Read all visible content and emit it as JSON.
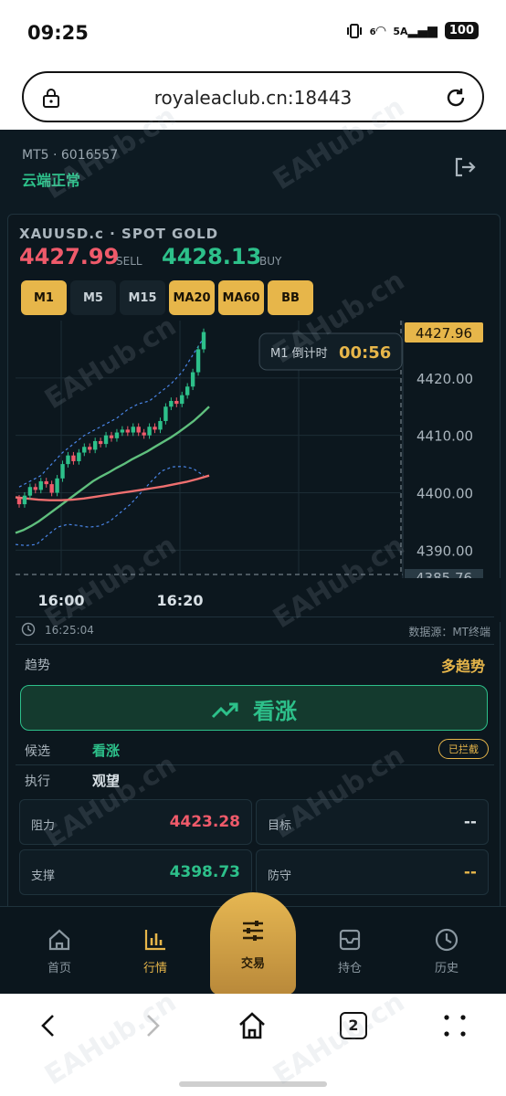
{
  "status": {
    "time": "09:25",
    "network": "5A",
    "wifi_label": "6",
    "battery": "100"
  },
  "browser": {
    "url": "royaleaclub.cn:18443",
    "tab_count": "2"
  },
  "account": {
    "id": "MT5 · 6016557",
    "cloud_status": "云端正常"
  },
  "symbol": {
    "name": "XAUUSD.c · SPOT GOLD",
    "sell_price": "4427.99",
    "sell_label": "SELL",
    "buy_price": "4428.13",
    "buy_label": "BUY"
  },
  "timeframes": [
    {
      "label": "M1",
      "active": true
    },
    {
      "label": "M5",
      "active": false
    },
    {
      "label": "M15",
      "active": false
    }
  ],
  "indicators": [
    "MA20",
    "MA60",
    "BB"
  ],
  "chart_data": {
    "type": "candlestick",
    "y_ticks": [
      "4420.00",
      "4410.00",
      "4400.00",
      "4390.00"
    ],
    "ylim": [
      4385.76,
      4430
    ],
    "x_ticks": [
      "16:00",
      "16:20"
    ],
    "current_price_tag": "4427.96",
    "bottom_price_tag": "4385.76",
    "countdown_label": "M1 倒计时",
    "countdown_value": "00:56",
    "candles": [
      {
        "o": 4399.0,
        "c": 4398.0
      },
      {
        "o": 4398.0,
        "c": 4399.5
      },
      {
        "o": 4399.5,
        "c": 4401.0
      },
      {
        "o": 4401.0,
        "c": 4400.5
      },
      {
        "o": 4400.5,
        "c": 4402.0
      },
      {
        "o": 4402.0,
        "c": 4401.5
      },
      {
        "o": 4401.5,
        "c": 4400.0
      },
      {
        "o": 4400.0,
        "c": 4402.5
      },
      {
        "o": 4402.5,
        "c": 4405.0
      },
      {
        "o": 4405.0,
        "c": 4406.5
      },
      {
        "o": 4406.5,
        "c": 4405.5
      },
      {
        "o": 4405.5,
        "c": 4407.0
      },
      {
        "o": 4407.0,
        "c": 4408.0
      },
      {
        "o": 4408.0,
        "c": 4407.5
      },
      {
        "o": 4407.5,
        "c": 4409.0
      },
      {
        "o": 4409.0,
        "c": 4408.5
      },
      {
        "o": 4408.5,
        "c": 4410.0
      },
      {
        "o": 4410.0,
        "c": 4409.5
      },
      {
        "o": 4409.5,
        "c": 4410.5
      },
      {
        "o": 4410.5,
        "c": 4411.0
      },
      {
        "o": 4411.0,
        "c": 4410.5
      },
      {
        "o": 4410.5,
        "c": 4411.5
      },
      {
        "o": 4411.5,
        "c": 4410.5
      },
      {
        "o": 4410.5,
        "c": 4410.0
      },
      {
        "o": 4410.0,
        "c": 4411.5
      },
      {
        "o": 4411.5,
        "c": 4411.0
      },
      {
        "o": 4411.0,
        "c": 4412.5
      },
      {
        "o": 4412.5,
        "c": 4415.0
      },
      {
        "o": 4415.0,
        "c": 4416.0
      },
      {
        "o": 4416.0,
        "c": 4415.5
      },
      {
        "o": 4415.5,
        "c": 4417.0
      },
      {
        "o": 4417.0,
        "c": 4418.5
      },
      {
        "o": 4418.5,
        "c": 4421.0
      },
      {
        "o": 4421.0,
        "c": 4425.0
      },
      {
        "o": 4425.0,
        "c": 4428.0
      }
    ],
    "ma20": [
      4393.0,
      4393.5,
      4394.2,
      4395.0,
      4396.0,
      4397.0,
      4398.0,
      4399.0,
      4400.0,
      4401.0,
      4402.0,
      4402.8,
      4403.5,
      4404.3,
      4405.0,
      4405.8,
      4406.5,
      4407.2,
      4408.0,
      4408.8,
      4409.6,
      4410.5,
      4411.5,
      4412.5,
      4413.7,
      4415.0
    ],
    "ma60": [
      4399.2,
      4399.0,
      4398.8,
      4398.7,
      4398.7,
      4398.8,
      4399.0,
      4399.3,
      4399.6,
      4399.9,
      4400.2,
      4400.5,
      4400.8,
      4401.1,
      4401.5,
      4401.9,
      4402.4,
      4403.0
    ],
    "bb_upper": [
      4401.0,
      4402.0,
      4403.0,
      4405.0,
      4407.0,
      4408.5,
      4410.0,
      4411.0,
      4412.0,
      4413.0,
      4414.5,
      4415.5,
      4416.0,
      4417.5,
      4419.0,
      4421.0,
      4424.0,
      4427.0
    ],
    "bb_lower": [
      4391.0,
      4390.8,
      4391.0,
      4392.5,
      4394.0,
      4394.5,
      4394.3,
      4394.0,
      4394.2,
      4395.0,
      4396.5,
      4398.0,
      4400.0,
      4402.0,
      4403.8,
      4404.5,
      4404.6,
      4404.2,
      4403.0
    ]
  },
  "timestamp": {
    "time": "16:25:04",
    "source": "数据源：MT终端"
  },
  "trend": {
    "label": "趋势",
    "value": "多趋势"
  },
  "signal": {
    "text": "看涨"
  },
  "candidate": {
    "label": "候选",
    "value": "看涨",
    "badge": "已拦截"
  },
  "execution": {
    "label": "执行",
    "value": "观望"
  },
  "metrics": {
    "resistance": {
      "label": "阻力",
      "value": "4423.28"
    },
    "target": {
      "label": "目标",
      "value": "--"
    },
    "support": {
      "label": "支撑",
      "value": "4398.73"
    },
    "defense": {
      "label": "防守",
      "value": "--"
    }
  },
  "nav": [
    {
      "label": "首页",
      "icon": "home-icon"
    },
    {
      "label": "行情",
      "icon": "chart-bar-icon"
    },
    {
      "label": "交易",
      "icon": "sliders-icon"
    },
    {
      "label": "持仓",
      "icon": "inbox-icon"
    },
    {
      "label": "历史",
      "icon": "clock-icon"
    }
  ],
  "watermark": "EAHub.cn",
  "colors": {
    "up": "#2dc08a",
    "down": "#ef5a6a",
    "accent": "#e7b64a",
    "bg": "#0d1a22"
  }
}
